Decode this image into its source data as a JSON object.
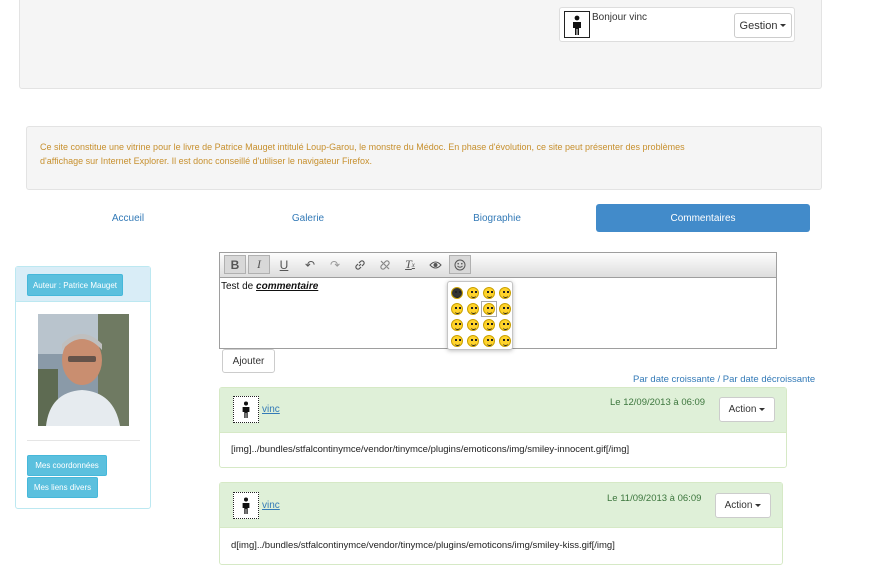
{
  "header": {
    "greeting": "Bonjour vinc",
    "gestion_label": "Gestion"
  },
  "notice": {
    "line1": "Ce site constitue une vitrine pour le livre de Patrice Mauget intitulé Loup-Garou, le monstre du Médoc. En phase d'évolution, ce site peut présenter des problèmes",
    "line2": "d'affichage sur Internet Explorer. Il est donc conseillé d'utiliser le navigateur Firefox."
  },
  "nav": {
    "items": [
      {
        "label": "Accueil"
      },
      {
        "label": "Galerie"
      },
      {
        "label": "Biographie"
      },
      {
        "label": "Commentaires"
      }
    ],
    "active_color": "#428bca"
  },
  "sidebar": {
    "author_label": "Auteur : Patrice Mauget",
    "coords_label": "Mes coordonnées",
    "links_label": "Mes liens divers"
  },
  "editor": {
    "content_plain": "Test de ",
    "content_emph": "commentaire",
    "toolbar": [
      "bold-icon",
      "italic-icon",
      "underline-icon",
      "undo-icon",
      "redo-icon",
      "link-icon",
      "unlink-icon",
      "remove-format-icon",
      "preview-icon",
      "emoticons-icon"
    ],
    "add_label": "Ajouter"
  },
  "sort": {
    "ascending": "Par date croissante",
    "separator": " / ",
    "descending": "Par date décroissante"
  },
  "comments": [
    {
      "author": "vinc",
      "date": "Le 12/09/2013 à 06:09",
      "action_label": "Action",
      "text": "[img]../bundles/stfalcontinymce/vendor/tinymce/plugins/emoticons/img/smiley-innocent.gif[/img]"
    },
    {
      "author": "vinc",
      "date": "Le 11/09/2013 à 06:09",
      "action_label": "Action",
      "text": "d[img]../bundles/stfalcontinymce/vendor/tinymce/plugins/emoticons/img/smiley-kiss.gif[/img]"
    }
  ]
}
